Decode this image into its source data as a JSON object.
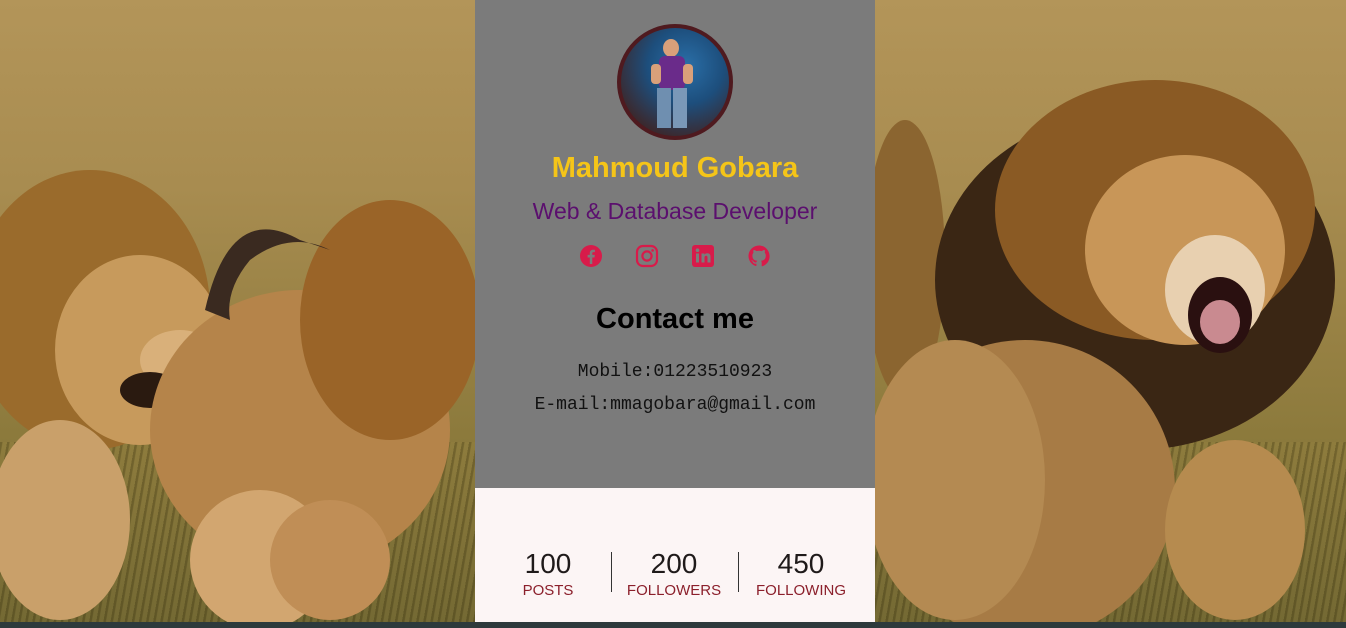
{
  "profile": {
    "name": "Mahmoud Gobara",
    "role": "Web & Database Developer"
  },
  "socials": [
    {
      "icon": "facebook-icon"
    },
    {
      "icon": "instagram-icon"
    },
    {
      "icon": "linkedin-icon"
    },
    {
      "icon": "github-icon"
    }
  ],
  "contact": {
    "title": "Contact me",
    "mobile": "Mobile:01223510923",
    "email": "E-mail:mmagobara@gmail.com"
  },
  "stats": [
    {
      "value": "100",
      "label": "POSTS"
    },
    {
      "value": "200",
      "label": "FOLLOWERS"
    },
    {
      "value": "450",
      "label": "FOLLOWING"
    }
  ],
  "colors": {
    "name": "#f5c518",
    "role": "#5b0f6e",
    "social_icons": "#d81b4a",
    "stat_label": "#8b1f2b",
    "card_bg": "#7b7b7b",
    "stats_bg": "#fcf5f5"
  }
}
